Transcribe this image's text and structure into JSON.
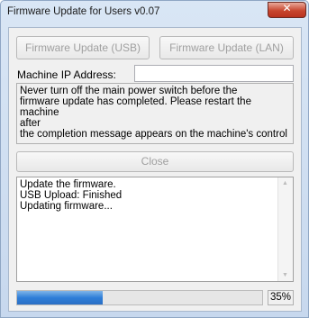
{
  "window": {
    "title": "Firmware Update for Users v0.07",
    "close_glyph": "✕"
  },
  "buttons": {
    "usb_label": "Firmware Update (USB)",
    "lan_label": "Firmware Update (LAN)",
    "close_label": "Close"
  },
  "ip": {
    "label": "Machine IP Address:",
    "value": ""
  },
  "message": {
    "text": "Never turn off the main power switch before the\nfirmware update has completed. Please restart the machine\nafter\nthe completion message appears on the machine's control"
  },
  "log": {
    "lines": [
      "Update the firmware.",
      "USB Upload: Finished",
      "Updating firmware..."
    ],
    "scroll_up_icon": "scroll-up-arrow",
    "scroll_down_icon": "scroll-down-arrow"
  },
  "progress": {
    "percent": 35,
    "label": "35%"
  },
  "colors": {
    "progress_fill": "#2f7ed8",
    "close_button": "#c8462f"
  }
}
